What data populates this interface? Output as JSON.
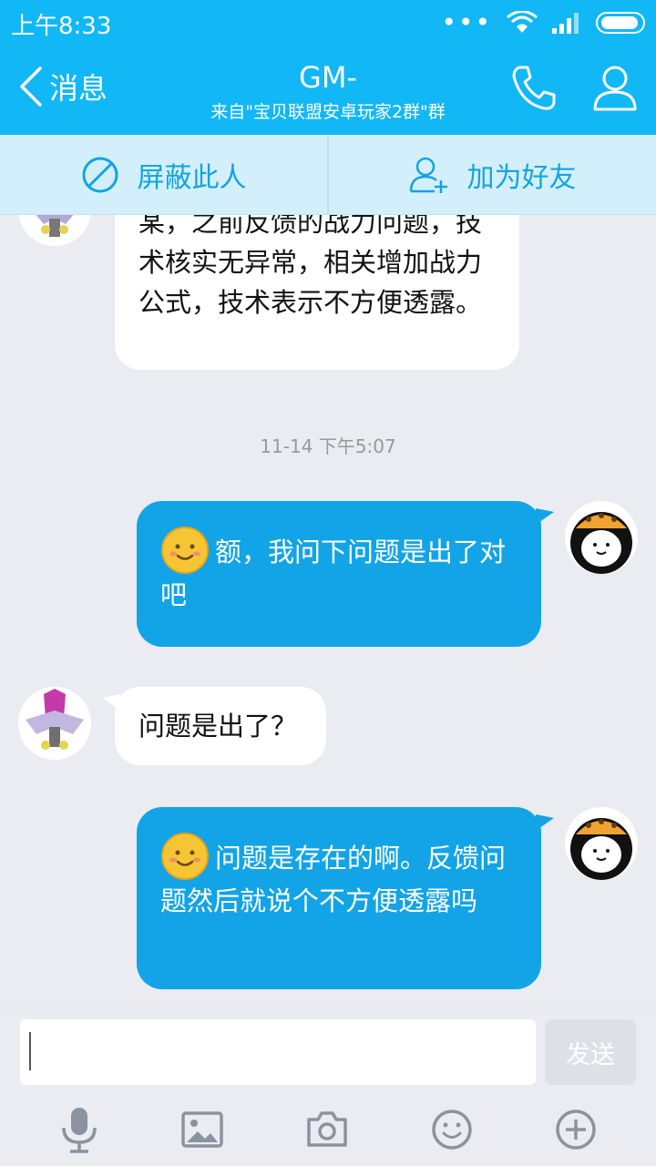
{
  "status_bar": {
    "time": "上午8:33",
    "dots": "•••"
  },
  "header": {
    "back_label": "消息",
    "title": "GM-",
    "subtitle": "来自\"宝贝联盟安卓玩家2群\"群"
  },
  "actions": {
    "block_label": "屏蔽此人",
    "add_friend_label": "加为好友"
  },
  "messages": [
    {
      "sender": "gm",
      "text": "某，之前反馈的战力问题，技术核实无异常，相关增加战力公式，技术表示不方便透露。"
    },
    {
      "type": "timestamp",
      "text": "11-14 下午5:07"
    },
    {
      "sender": "me",
      "text": "额，我问下问题是出了对吧"
    },
    {
      "sender": "gm",
      "text": "问题是出了？"
    },
    {
      "sender": "me",
      "text": "问题是存在的啊。反馈问题然后就说个不方便透露吗"
    }
  ],
  "input": {
    "value": "",
    "send_label": "发送"
  },
  "toolbar_icons": [
    "microphone-icon",
    "image-icon",
    "camera-icon",
    "emoji-icon",
    "plus-icon"
  ],
  "colors": {
    "accent": "#12b7f5",
    "bubble_out": "#12a4e6",
    "action_text": "#12a4e0"
  }
}
